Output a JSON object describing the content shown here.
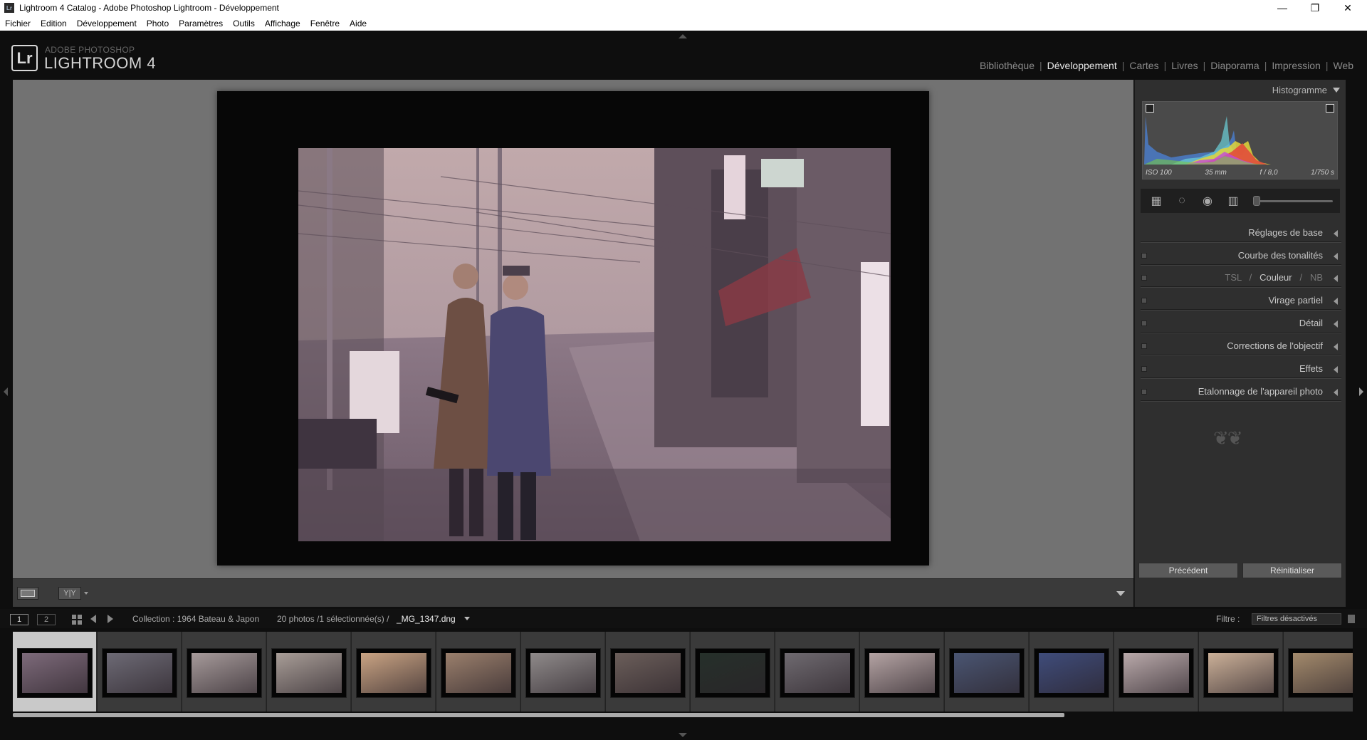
{
  "window": {
    "app_icon": "Lr",
    "title": "Lightroom 4 Catalog - Adobe Photoshop Lightroom - Développement",
    "minimize": "—",
    "maximize": "❐",
    "close": "✕"
  },
  "menu": [
    "Fichier",
    "Edition",
    "Développement",
    "Photo",
    "Paramètres",
    "Outils",
    "Affichage",
    "Fenêtre",
    "Aide"
  ],
  "logo": {
    "mark": "Lr",
    "sub": "ADOBE PHOTOSHOP",
    "main": "LIGHTROOM 4"
  },
  "modules": [
    {
      "label": "Bibliothèque",
      "active": false
    },
    {
      "label": "Développement",
      "active": true
    },
    {
      "label": "Cartes",
      "active": false
    },
    {
      "label": "Livres",
      "active": false
    },
    {
      "label": "Diaporama",
      "active": false
    },
    {
      "label": "Impression",
      "active": false
    },
    {
      "label": "Web",
      "active": false
    }
  ],
  "toolbar": {
    "yy_label": "Y|Y"
  },
  "panel": {
    "histogram_title": "Histogramme",
    "histo_meta": {
      "iso": "ISO 100",
      "focal": "35 mm",
      "aperture": "f / 8,0",
      "shutter": "1/750 s"
    },
    "sections": [
      {
        "label": "Réglages de base",
        "switch": false
      },
      {
        "label": "Courbe des tonalités",
        "switch": true
      },
      {
        "label": "TSL / Couleur / NB",
        "switch": true,
        "parts": [
          "TSL",
          "Couleur",
          "NB"
        ]
      },
      {
        "label": "Virage partiel",
        "switch": true
      },
      {
        "label": "Détail",
        "switch": true
      },
      {
        "label": "Corrections de l'objectif",
        "switch": true
      },
      {
        "label": "Effets",
        "switch": true
      },
      {
        "label": "Etalonnage de l'appareil photo",
        "switch": true
      }
    ],
    "btn_previous": "Précédent",
    "btn_reset": "Réinitialiser"
  },
  "filmbar": {
    "monitor1": "1",
    "monitor2": "2",
    "collection": "Collection : 1964 Bateau & Japon",
    "count": "20 photos /1 sélectionnée(s) /",
    "filename": "_MG_1347.dng",
    "filter_label": "Filtre :",
    "filter_value": "Filtres désactivés"
  },
  "thumbnails": [
    {
      "selected": true,
      "color": "#7d6a7a"
    },
    {
      "selected": false,
      "color": "#6d6a75"
    },
    {
      "selected": false,
      "color": "#a69a9a"
    },
    {
      "selected": false,
      "color": "#a89d97"
    },
    {
      "selected": false,
      "color": "#c9a383"
    },
    {
      "selected": false,
      "color": "#9a7f6c"
    },
    {
      "selected": false,
      "color": "#8f8a8a"
    },
    {
      "selected": false,
      "color": "#6b5e5a"
    },
    {
      "selected": false,
      "color": "#26302a"
    },
    {
      "selected": false,
      "color": "#6f6a70"
    },
    {
      "selected": false,
      "color": "#b4a3a3"
    },
    {
      "selected": false,
      "color": "#4a5572"
    },
    {
      "selected": false,
      "color": "#3f4c7a"
    },
    {
      "selected": false,
      "color": "#b9a9aa"
    },
    {
      "selected": false,
      "color": "#cbb098"
    },
    {
      "selected": false,
      "color": "#a38a6c"
    }
  ]
}
